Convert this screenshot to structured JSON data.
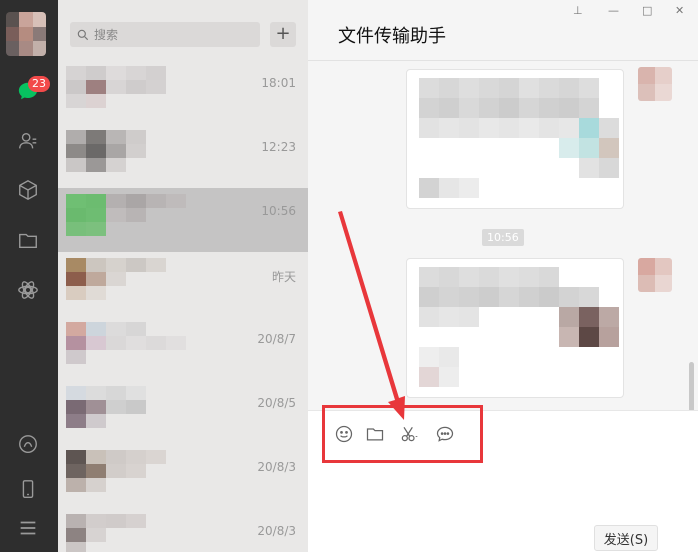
{
  "sidebar": {
    "unread_badge": "23",
    "icons": [
      "chat-icon",
      "contacts-icon",
      "favorites-icon",
      "files-icon",
      "mini-programs-icon",
      "moments-icon",
      "phone-icon",
      "menu-icon"
    ]
  },
  "search": {
    "placeholder": "搜索",
    "add_label": "+"
  },
  "conversations": [
    {
      "time": "18:01"
    },
    {
      "time": "12:23"
    },
    {
      "time": "10:56",
      "active": true
    },
    {
      "time": "昨天"
    },
    {
      "time": "20/8/7"
    },
    {
      "time": "20/8/5"
    },
    {
      "time": "20/8/3"
    },
    {
      "time": "20/8/3"
    }
  ],
  "chat": {
    "title": "文件传输助手",
    "timestamp": "10:56",
    "window_controls": {
      "pin": "⊥",
      "minimize": "—",
      "maximize": "□",
      "close": "✕"
    }
  },
  "toolbar": {
    "tools": [
      "emoji-icon",
      "folder-icon",
      "screenshot-icon",
      "chat-history-icon"
    ],
    "send_label": "发送(S)"
  },
  "colors": {
    "sidebar": "#2e2e2e",
    "list_bg": "#e9e8e7",
    "active_row": "#c5c4c4",
    "badge": "#f24a4a",
    "annotation": "#e8373b"
  }
}
